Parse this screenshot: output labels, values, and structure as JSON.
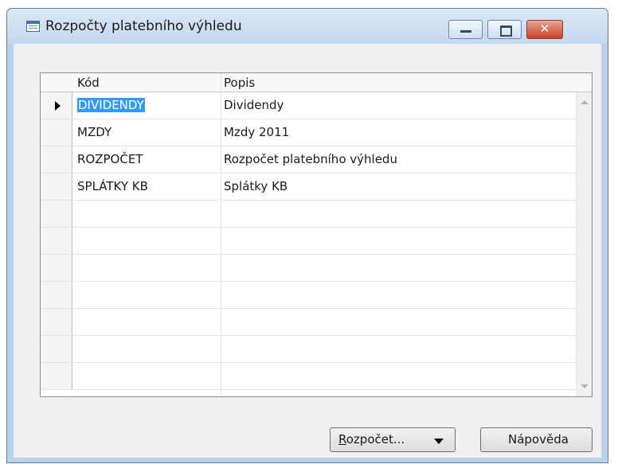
{
  "window": {
    "title": "Rozpočty platebního výhledu"
  },
  "window_controls": {
    "close_glyph": "✕"
  },
  "table": {
    "columns": [
      "Kód",
      "Popis"
    ],
    "rows": [
      {
        "code": "DIVIDENDY",
        "desc": "Dividendy"
      },
      {
        "code": "MZDY",
        "desc": "Mzdy 2011"
      },
      {
        "code": "ROZPOČET",
        "desc": "Rozpočet platebního výhledu"
      },
      {
        "code": "SPLÁTKY KB",
        "desc": "Splátky KB"
      }
    ],
    "empty_rows": 7,
    "selected_row": 0
  },
  "buttons": {
    "budget": {
      "accel": "R",
      "rest": "ozpočet..."
    },
    "help": "Nápověda"
  },
  "colors": {
    "selection": "#3399ff",
    "close_button": "#c7422c"
  }
}
